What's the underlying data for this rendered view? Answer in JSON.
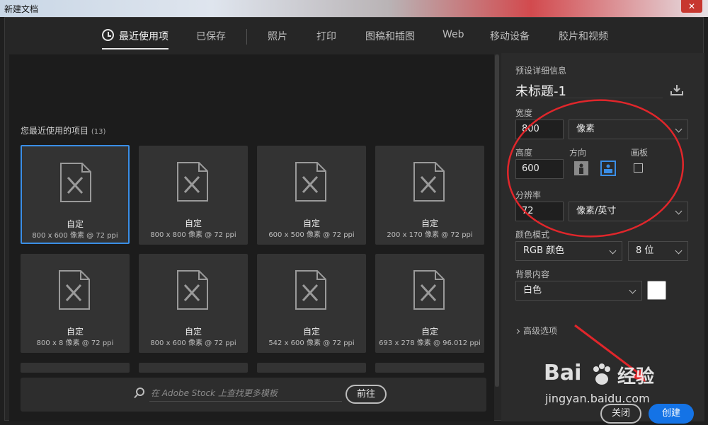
{
  "window": {
    "title": "新建文档",
    "close_glyph": "✕"
  },
  "tabs": [
    {
      "label": "最近使用项",
      "active": true
    },
    {
      "label": "已保存"
    },
    {
      "label": "照片"
    },
    {
      "label": "打印"
    },
    {
      "label": "图稿和插图"
    },
    {
      "label": "Web"
    },
    {
      "label": "移动设备"
    },
    {
      "label": "胶片和视频"
    }
  ],
  "recent": {
    "heading": "您最近使用的项目",
    "count": "(13)",
    "items": [
      {
        "name": "自定",
        "size": "800 x 600 像素 @ 72 ppi"
      },
      {
        "name": "自定",
        "size": "800 x 800 像素 @ 72 ppi"
      },
      {
        "name": "自定",
        "size": "600 x 500 像素 @ 72 ppi"
      },
      {
        "name": "自定",
        "size": "200 x 170 像素 @ 72 ppi"
      },
      {
        "name": "自定",
        "size": "800 x 8 像素 @ 72 ppi"
      },
      {
        "name": "自定",
        "size": "800 x 600 像素 @ 72 ppi"
      },
      {
        "name": "自定",
        "size": "542 x 600 像素 @ 72 ppi"
      },
      {
        "name": "自定",
        "size": "693 x 278 像素 @ 96.012 ppi"
      }
    ]
  },
  "stock": {
    "placeholder": "在 Adobe Stock 上查找更多模板",
    "go_label": "前往"
  },
  "preset": {
    "section_label": "预设详细信息",
    "doc_title": "未标题-1",
    "width_label": "宽度",
    "width_value": "800",
    "width_unit": "像素",
    "height_label": "高度",
    "height_value": "600",
    "orientation_label": "方向",
    "artboard_label": "画板",
    "resolution_label": "分辨率",
    "resolution_value": "72",
    "resolution_unit": "像素/英寸",
    "color_mode_label": "颜色模式",
    "color_mode": "RGB 颜色",
    "bit_depth": "8 位",
    "background_label": "背景内容",
    "background": "白色",
    "background_color": "#ffffff",
    "advanced_label": "高级选项",
    "close_label": "关闭",
    "create_label": "创建"
  },
  "colors": {
    "accent": "#1473e6",
    "selected_border": "#3a8ee6",
    "annotation": "#e0262b"
  },
  "watermark": {
    "brand": "Bai",
    "brand2": "经验",
    "url": "jingyan.baidu.com"
  }
}
